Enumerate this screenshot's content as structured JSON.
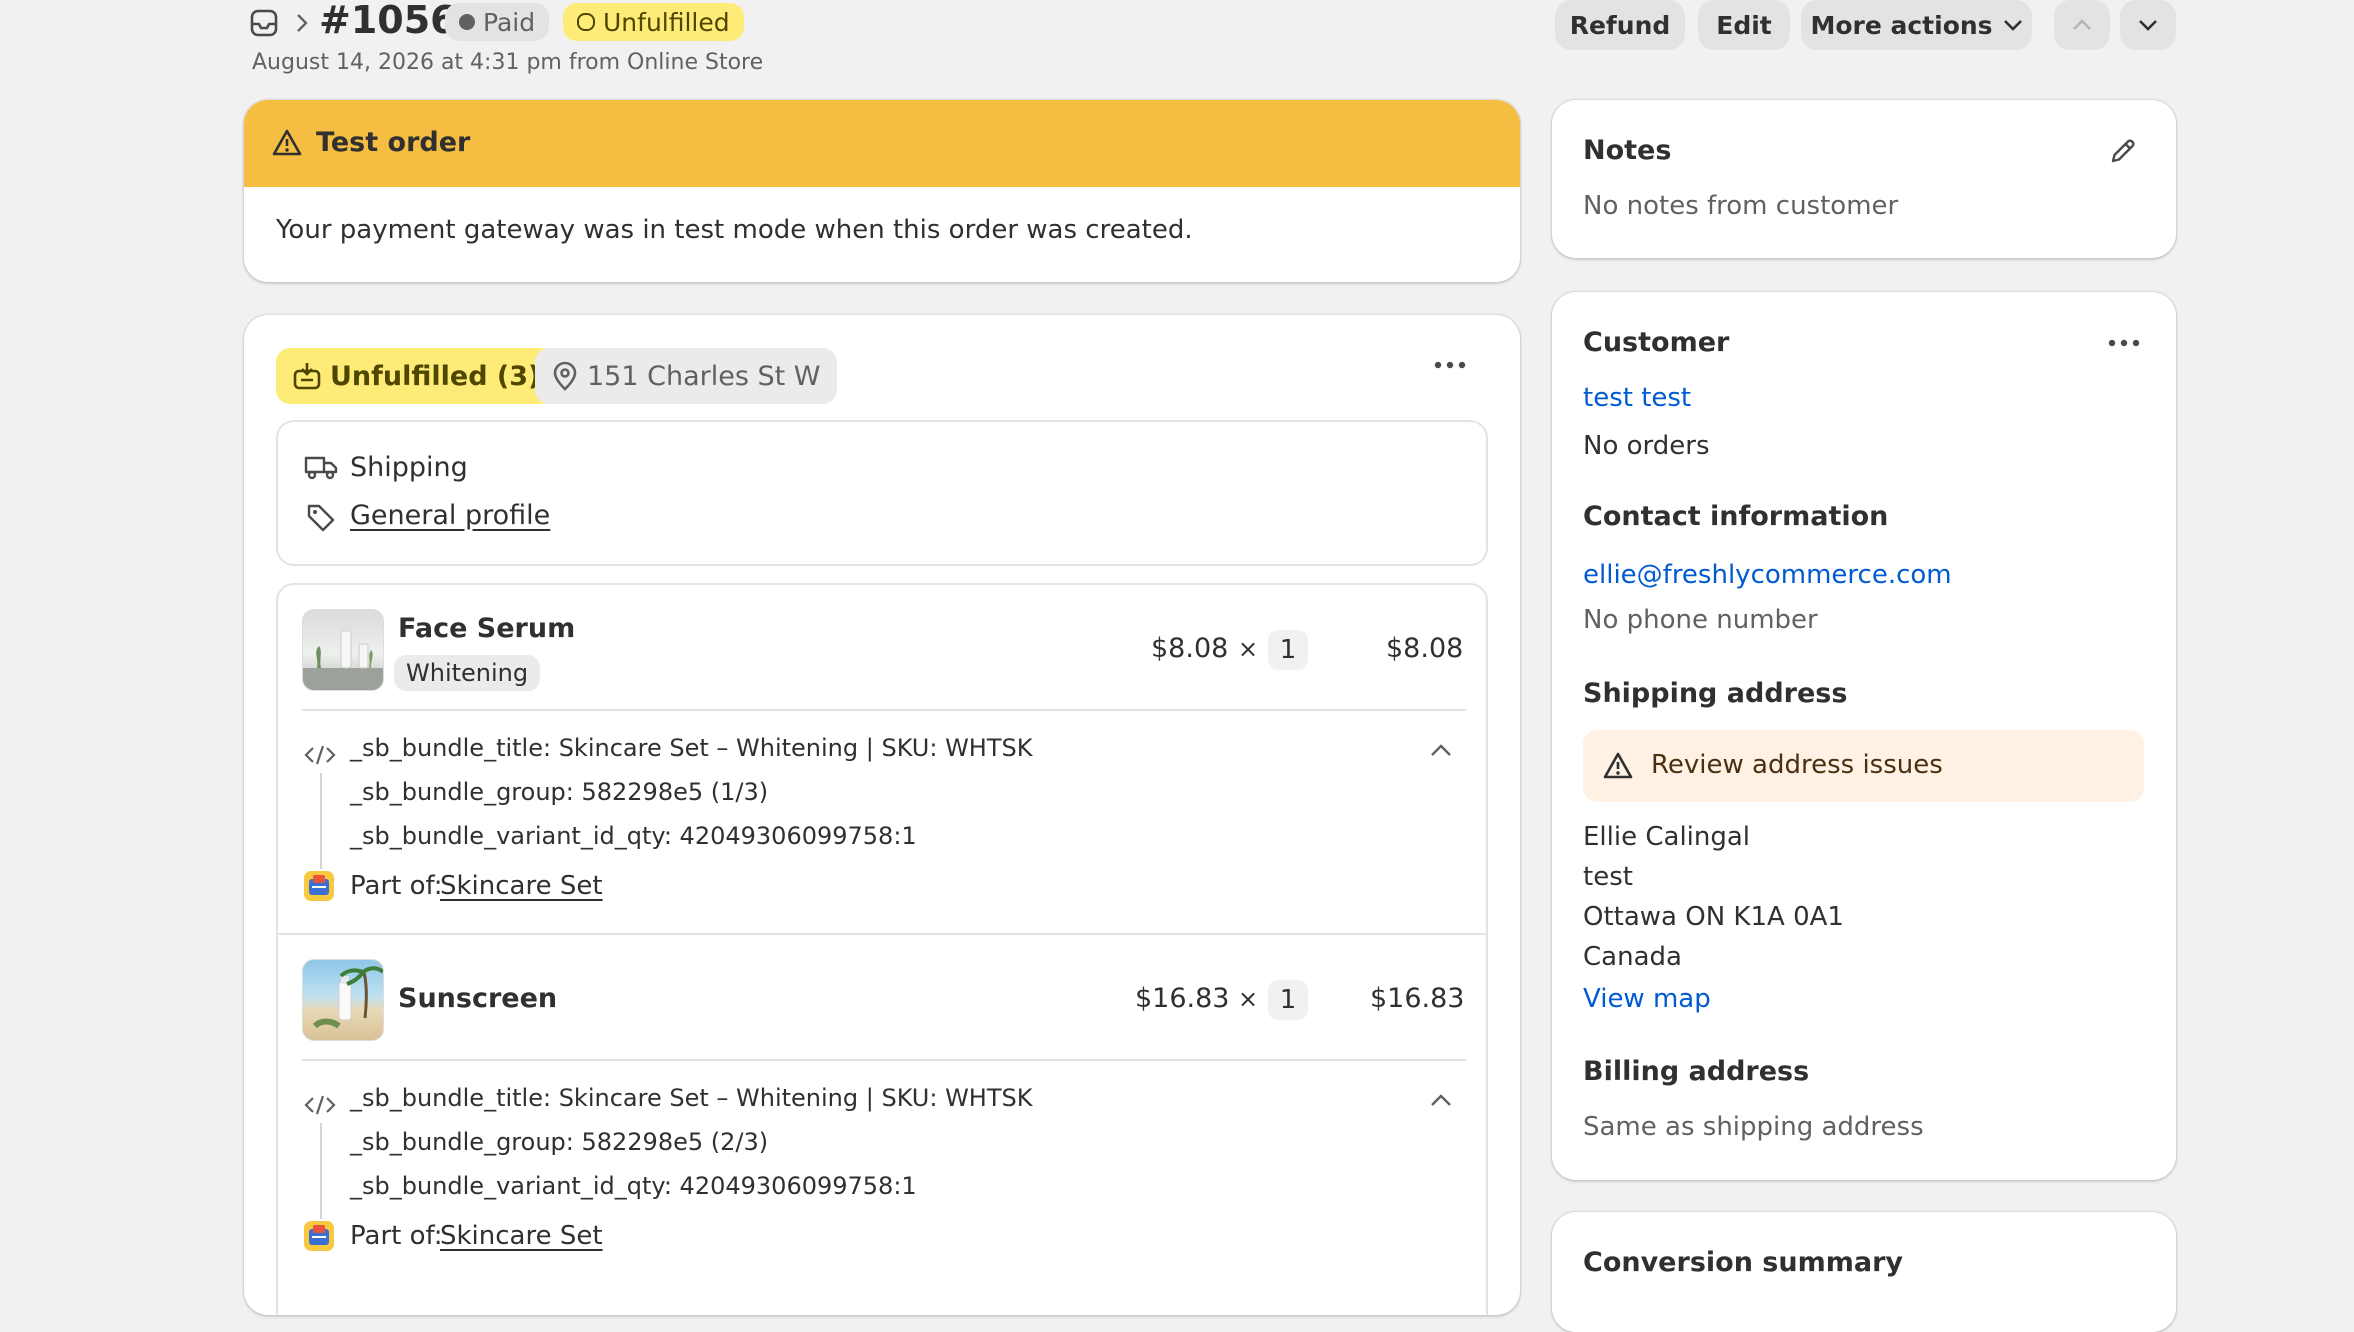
{
  "header": {
    "order_number": "#1056",
    "payment_badge": "Paid",
    "fulfillment_badge": "Unfulfilled",
    "subtitle": "August 14, 2026 at 4:31 pm from Online Store",
    "refund_label": "Refund",
    "edit_label": "Edit",
    "more_actions_label": "More actions"
  },
  "test_banner": {
    "title": "Test order",
    "message": "Your payment gateway was in test mode when this order was created."
  },
  "fulfillment": {
    "status_label": "Unfulfilled (3)",
    "location_label": "151 Charles St W",
    "shipping_label": "Shipping",
    "profile_label": "General profile",
    "line_items": [
      {
        "name": "Face Serum",
        "variant": "Whitening",
        "unit_price": "$8.08",
        "times": "×",
        "quantity": "1",
        "total": "$8.08",
        "properties": [
          "_sb_bundle_title: Skincare Set – Whitening | SKU: WHTSK",
          "_sb_bundle_group: 582298e5 (1/3)",
          "_sb_bundle_variant_id_qty: 42049306099758:1"
        ],
        "part_of_label": "Part of:",
        "part_of_link": "Skincare Set"
      },
      {
        "name": "Sunscreen",
        "unit_price": "$16.83",
        "times": "×",
        "quantity": "1",
        "total": "$16.83",
        "properties": [
          "_sb_bundle_title: Skincare Set – Whitening | SKU: WHTSK",
          "_sb_bundle_group: 582298e5 (2/3)",
          "_sb_bundle_variant_id_qty: 42049306099758:1"
        ],
        "part_of_label": "Part of:",
        "part_of_link": "Skincare Set"
      }
    ]
  },
  "notes": {
    "title": "Notes",
    "text": "No notes from customer"
  },
  "customer": {
    "title": "Customer",
    "name": "test test",
    "orders": "No orders",
    "contact_title": "Contact information",
    "email": "ellie@freshlycommerce.com",
    "phone": "No phone number",
    "shipping_title": "Shipping address",
    "address_warning": "Review address issues",
    "address_lines": [
      "Ellie Calingal",
      "test",
      "Ottawa ON K1A 0A1",
      "Canada"
    ],
    "view_map": "View map",
    "billing_title": "Billing address",
    "billing_text": "Same as shipping address"
  },
  "conversion": {
    "title": "Conversion summary"
  },
  "colors": {
    "background": "#f1f1f1",
    "banner_warning": "#f5bd42",
    "badge_unfulfilled": "#ffeb78",
    "link": "#005bd3",
    "address_warning_bg": "#fff1e3"
  }
}
